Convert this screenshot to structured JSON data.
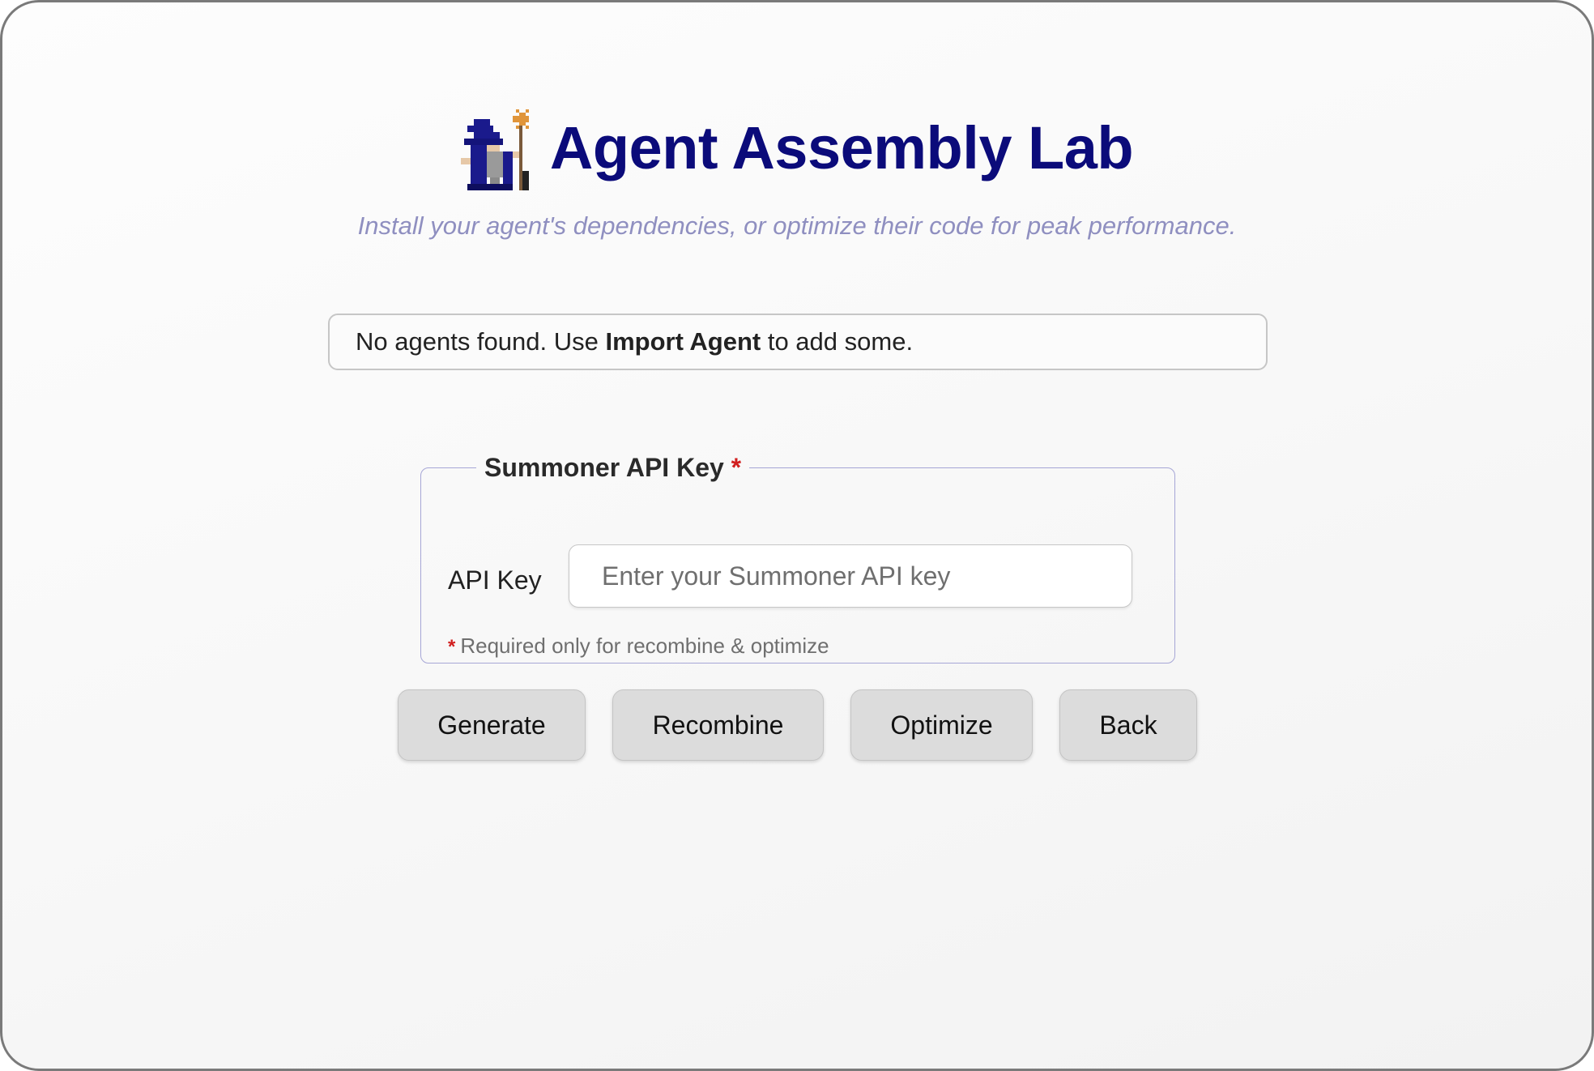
{
  "header": {
    "title": "Agent Assembly Lab",
    "subtitle": "Install your agent's dependencies, or optimize their code for peak performance.",
    "logo_icon": "pixel-wizard-icon"
  },
  "notice": {
    "text_before": "No agents found. Use ",
    "text_bold": "Import Agent",
    "text_after": " to add some."
  },
  "api_key_section": {
    "legend": "Summoner API Key",
    "required_marker": "*",
    "field_label": "API Key",
    "input_value": "",
    "input_placeholder": "Enter your Summoner API key",
    "note": "Required only for recombine & optimize"
  },
  "actions": {
    "generate_label": "Generate",
    "recombine_label": "Recombine",
    "optimize_label": "Optimize",
    "back_label": "Back"
  },
  "colors": {
    "title": "#0b0b7a",
    "subtitle": "#8f8fc0",
    "required": "#d11f1f",
    "fieldset_border": "#a6a6d6",
    "button_bg": "#dcdcdc"
  }
}
